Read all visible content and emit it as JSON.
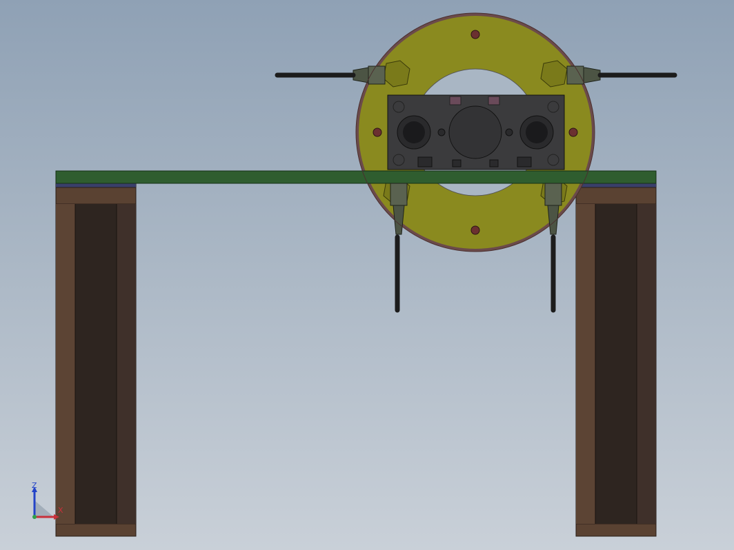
{
  "viewport": {
    "title": "",
    "background_top": "#8fa1b5",
    "background_bottom": "#c9d0d8"
  },
  "colors": {
    "leg_outer": "#5a4232",
    "leg_inner": "#2e2520",
    "leg_face": "#3a2e27",
    "plate_green": "#2f5d2f",
    "plate_blue": "#3a3f6a",
    "ring_olive": "#8a8a1f",
    "ring_edge": "#6b4a4a",
    "cylinder_block": "#3b3b3d",
    "cable": "#1c1c1c",
    "fitting": "#4c5444"
  },
  "triad": {
    "z_label": "Z",
    "x_label": "X",
    "z_color": "#2343c8",
    "x_color": "#c8303a"
  }
}
